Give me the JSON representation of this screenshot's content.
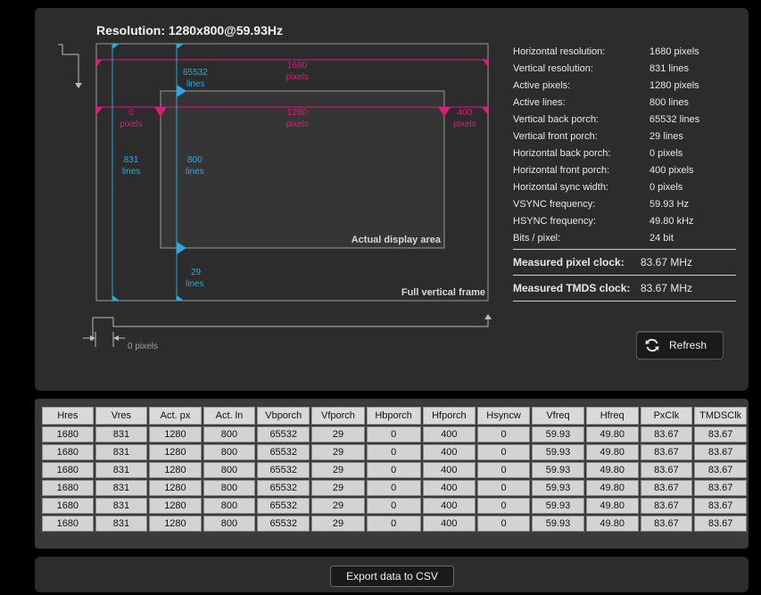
{
  "header": {
    "title": "Resolution: 1280x800@59.93Hz"
  },
  "diagram": {
    "hres_value": "1680",
    "hres_unit": "pixels",
    "vbp_value": "65532",
    "vbp_unit": "lines",
    "hbp_value": "0",
    "hbp_unit": "pixels",
    "active_px_value": "1280",
    "active_px_unit": "pixels",
    "hfp_value": "400",
    "hfp_unit": "pixels",
    "vres_value": "831",
    "vres_unit": "lines",
    "active_lines_value": "800",
    "active_lines_unit": "lines",
    "vfp_value": "29",
    "vfp_unit": "lines",
    "actual_area_label": "Actual display area",
    "full_frame_label": "Full vertical frame",
    "hsync_label": "0 pixels"
  },
  "info": {
    "rows": [
      {
        "label": "Horizontal resolution:",
        "value": "1680 pixels"
      },
      {
        "label": "Vertical resolution:",
        "value": "831 lines"
      },
      {
        "label": "Active pixels:",
        "value": "1280 pixels"
      },
      {
        "label": "Active lines:",
        "value": "800 lines"
      },
      {
        "label": "Vertical back porch:",
        "value": "65532 lines"
      },
      {
        "label": "Vertical front porch:",
        "value": "29 lines"
      },
      {
        "label": "Horizontal back porch:",
        "value": "0 pixels"
      },
      {
        "label": "Horizontal front porch:",
        "value": "400 pixels"
      },
      {
        "label": "Horizontal sync width:",
        "value": "0 pixels"
      },
      {
        "label": "VSYNC frequency:",
        "value": "59.93 Hz"
      },
      {
        "label": "HSYNC frequency:",
        "value": "49.80 kHz"
      },
      {
        "label": "Bits / pixel:",
        "value": "24 bit"
      }
    ],
    "pixel_clock_label": "Measured pixel clock:",
    "pixel_clock_value": "83.67 MHz",
    "tmds_clock_label": "Measured TMDS clock:",
    "tmds_clock_value": "83.67 MHz"
  },
  "refresh": {
    "label": "Refresh",
    "icon": "refresh-icon"
  },
  "table": {
    "headers": [
      "Hres",
      "Vres",
      "Act. px",
      "Act. ln",
      "Vbporch",
      "Vfporch",
      "Hbporch",
      "Hfporch",
      "Hsyncw",
      "Vfreq",
      "Hfreq",
      "PxClk",
      "TMDSClk"
    ],
    "rows": [
      [
        "1680",
        "831",
        "1280",
        "800",
        "65532",
        "29",
        "0",
        "400",
        "0",
        "59.93",
        "49.80",
        "83.67",
        "83.67"
      ],
      [
        "1680",
        "831",
        "1280",
        "800",
        "65532",
        "29",
        "0",
        "400",
        "0",
        "59.93",
        "49.80",
        "83.67",
        "83.67"
      ],
      [
        "1680",
        "831",
        "1280",
        "800",
        "65532",
        "29",
        "0",
        "400",
        "0",
        "59.93",
        "49.80",
        "83.67",
        "83.67"
      ],
      [
        "1680",
        "831",
        "1280",
        "800",
        "65532",
        "29",
        "0",
        "400",
        "0",
        "59.93",
        "49.80",
        "83.67",
        "83.67"
      ],
      [
        "1680",
        "831",
        "1280",
        "800",
        "65532",
        "29",
        "0",
        "400",
        "0",
        "59.93",
        "49.80",
        "83.67",
        "83.67"
      ],
      [
        "1680",
        "831",
        "1280",
        "800",
        "65532",
        "29",
        "0",
        "400",
        "0",
        "59.93",
        "49.80",
        "83.67",
        "83.67"
      ]
    ]
  },
  "export": {
    "label": "Export data to CSV"
  },
  "colors": {
    "magenta": "#e0197e",
    "cyan": "#2aa9e0",
    "panel": "#2c2c2c"
  }
}
